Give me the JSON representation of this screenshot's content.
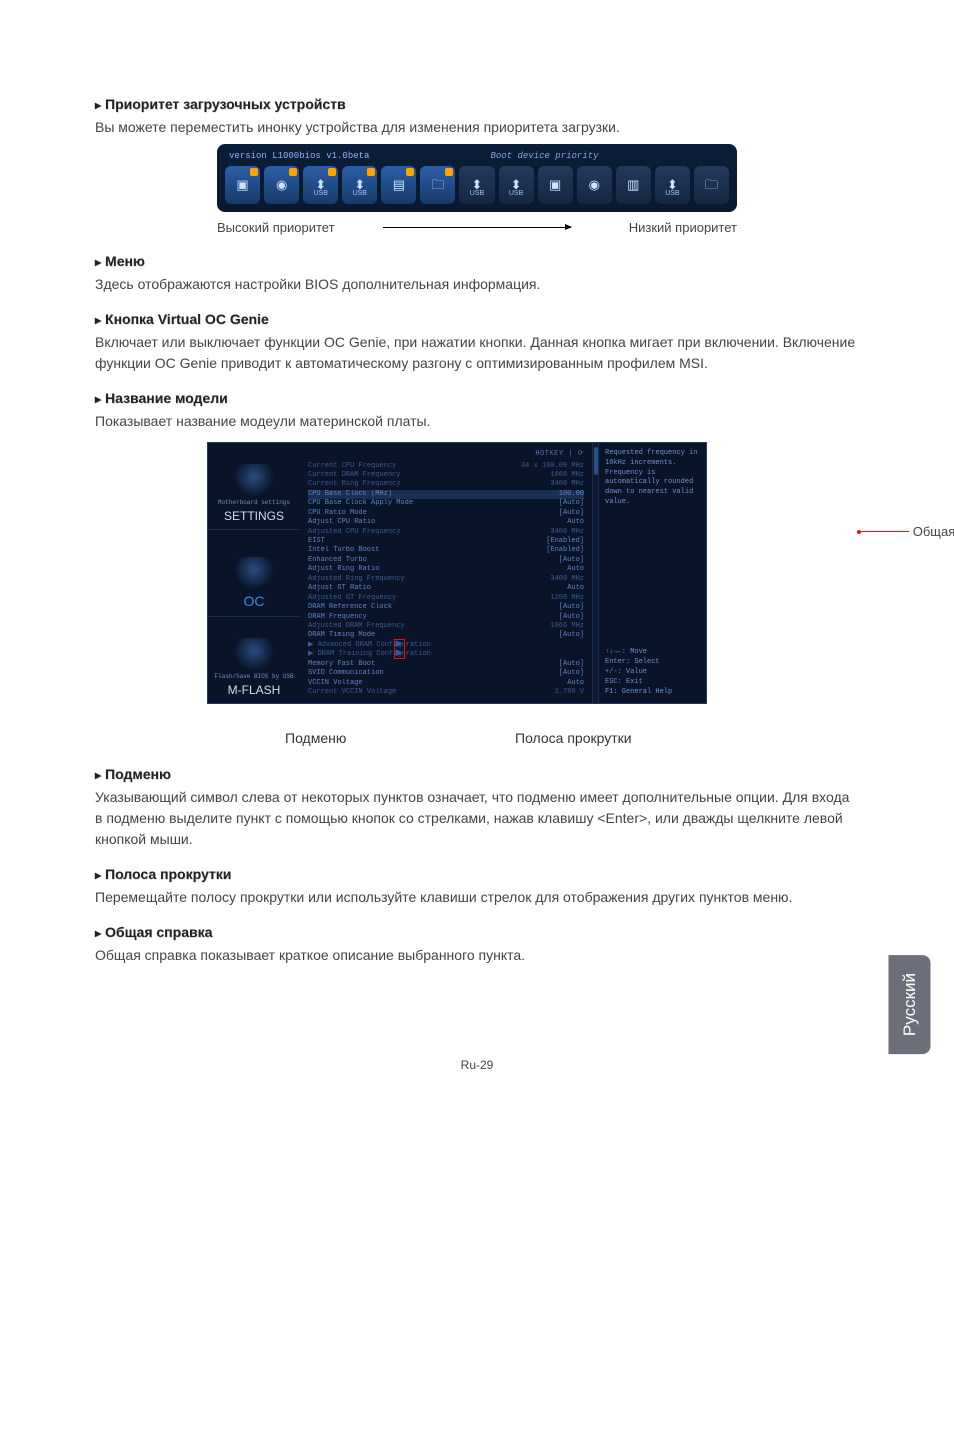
{
  "sections": {
    "priority": {
      "title": "Приоритет загрузочных устройств",
      "body": "Вы можете переместить инонку устройства для изменения приоритета загрузки."
    },
    "menu": {
      "title": "Меню",
      "body": "Здесь отображаются настройки BIOS дополнительная информация."
    },
    "ocgenie": {
      "title": "Кнопка Virtual OC Genie",
      "body": "Включает или выключает функции OC Genie, при нажатии кнопки. Данная кнопка мигает при включении. Включение функции OC Genie приводит к автоматическому разгону с оптимизированным профилем MSI."
    },
    "model": {
      "title": "Название модели",
      "body": "Показывает название модеули материнской платы."
    },
    "submenu": {
      "title": "Подменю",
      "body": "Указывающий символ слева от некоторых пунктов означает, что подменю имеет дополнительные опции.  Для входа в подменю выделите пункт с помощью кнопок со стрелками, нажав клавишу <Enter>, или дважды щелкните левой кнопкой мыши."
    },
    "scrollbar": {
      "title": "Полоса прокрутки",
      "body": "Перемещайте полосу прокрутки или используйте клавиши стрелок для отображения других пунктов меню."
    },
    "help": {
      "title": "Общая справка",
      "body": "Общая справка показывает краткое описание выбранного пункта."
    }
  },
  "boot": {
    "header_left": "version L1000bios v1.0beta",
    "header_title": "Boot device priority",
    "high_label": "Высокий приоритет",
    "low_label": "Низкий приоритет",
    "usb": "USB"
  },
  "bios": {
    "hotkey": "HOTKEY | ⟳",
    "left": {
      "settings_caption": "Motherboard settings",
      "settings": "SETTINGS",
      "oc": "OC",
      "mflash_caption": "Flash/Save BIOS by USB",
      "mflash": "M-FLASH"
    },
    "rows": [
      {
        "l": "Current CPU Frequency",
        "v": "34 x 100.00 MHz",
        "dim": true
      },
      {
        "l": "Current DRAM Frequency",
        "v": "1066 MHz",
        "dim": true
      },
      {
        "l": "Current Ring Frequency",
        "v": "3400 MHz",
        "dim": true
      },
      {
        "l": "CPU Base Clock (MHz)",
        "v": "100.00",
        "sel": true
      },
      {
        "l": "CPU Base Clock Apply Mode",
        "v": "[Auto]"
      },
      {
        "l": "CPU Ratio Mode",
        "v": "[Auto]"
      },
      {
        "l": "Adjust CPU Ratio",
        "v": "Auto"
      },
      {
        "l": "Adjusted CPU Frequency",
        "v": "3400 MHz",
        "dim": true
      },
      {
        "l": "EIST",
        "v": "[Enabled]"
      },
      {
        "l": "Intel Turbo Boost",
        "v": "[Enabled]"
      },
      {
        "l": "Enhanced Turbo",
        "v": "[Auto]"
      },
      {
        "l": "Adjust Ring Ratio",
        "v": "Auto"
      },
      {
        "l": "Adjusted Ring Frequency",
        "v": "3400 MHz",
        "dim": true
      },
      {
        "l": "Adjust GT Ratio",
        "v": "Auto"
      },
      {
        "l": "Adjusted GT Frequency",
        "v": "1200 MHz",
        "dim": true
      },
      {
        "l": "DRAM Reference Clock",
        "v": "[Auto]"
      },
      {
        "l": "DRAM Frequency",
        "v": "[Auto]"
      },
      {
        "l": "Adjusted DRAM Frequency",
        "v": "1066 MHz",
        "dim": true
      },
      {
        "l": "DRAM Timing Mode",
        "v": "[Auto]"
      },
      {
        "l": "Advanced DRAM Configuration",
        "v": "",
        "dim": true,
        "sub": true
      },
      {
        "l": "DRAM Training Configuration",
        "v": "",
        "dim": true,
        "sub": true
      },
      {
        "l": "Memory Fast Boot",
        "v": "[Auto]"
      },
      {
        "l": "SVID Communication",
        "v": "[Auto]"
      },
      {
        "l": "VCCIN Voltage",
        "v": "Auto"
      },
      {
        "l": "Current VCCIN Voltage",
        "v": "1.760 V",
        "dim": true
      }
    ],
    "help_text": "Requested frequency in 10kHz increments. Frequency is automatically rounded down to nearest valid value.",
    "keys": {
      "move": "↑↓→←: Move",
      "enter": "Enter: Select",
      "val": "+/-: Value",
      "esc": "ESC: Exit",
      "f1": "F1: General Help"
    },
    "callout_help": "Общая справка",
    "callout_sub": "Подменю",
    "callout_scroll": "Полоса прокрутки"
  },
  "lang_tab": "Русский",
  "page_num": "Ru-29"
}
